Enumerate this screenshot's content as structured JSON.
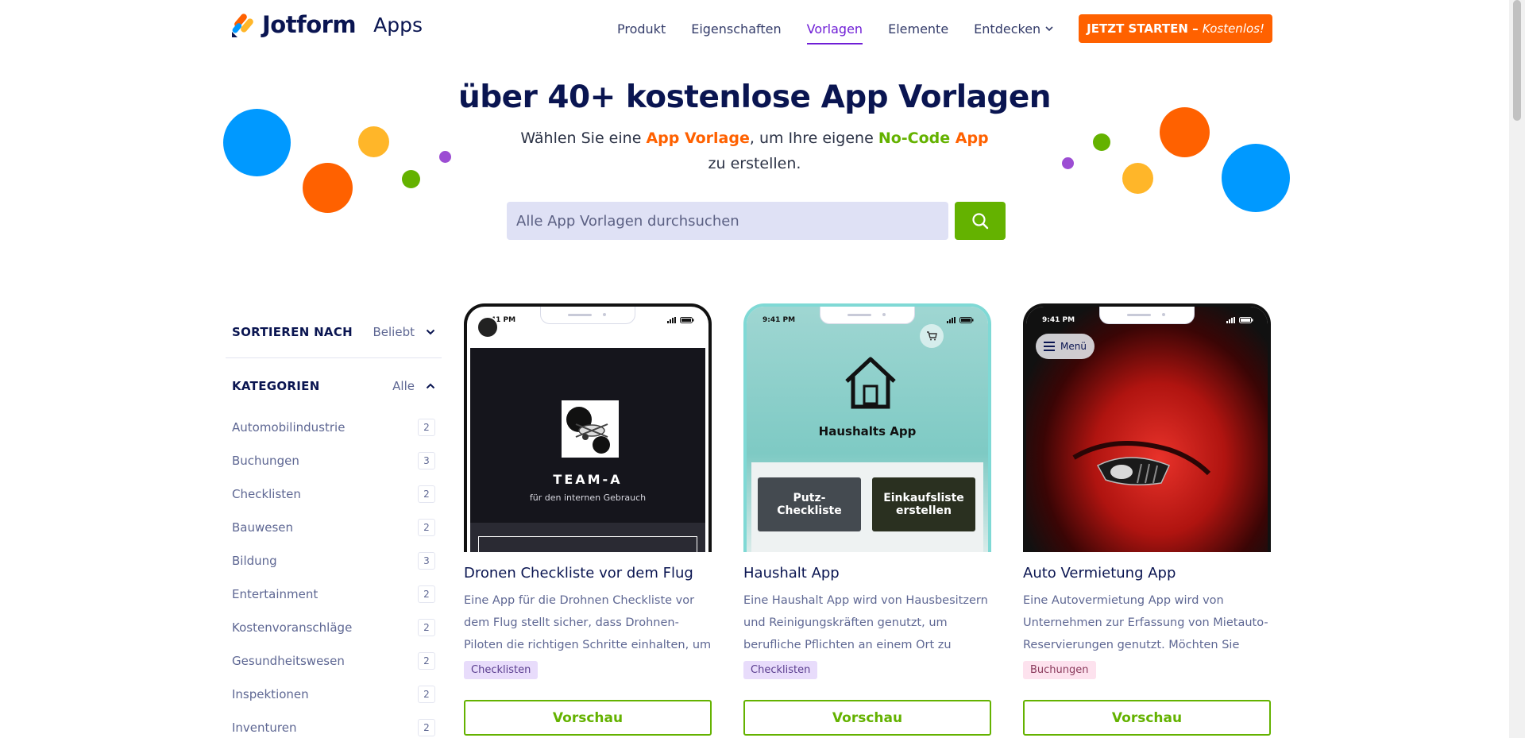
{
  "header": {
    "logo_text": "Jotform",
    "logo_sub": "Apps",
    "nav": [
      {
        "label": "Produkt",
        "active": false
      },
      {
        "label": "Eigenschaften",
        "active": false
      },
      {
        "label": "Vorlagen",
        "active": true
      },
      {
        "label": "Elemente",
        "active": false
      },
      {
        "label": "Entdecken",
        "active": false,
        "has_dropdown": true
      }
    ],
    "cta_main": "JETZT STARTEN",
    "cta_sep": " – ",
    "cta_em": "Kostenlos!"
  },
  "hero": {
    "title": "über 40+ kostenlose App Vorlagen",
    "sub_1": "Wählen Sie eine ",
    "sub_hl_1": "App Vorlage",
    "sub_2": ", um Ihre eigene ",
    "sub_hl_2": "No-Code",
    "sub_hl_3": " App",
    "sub_3": " zu erstellen.",
    "search_placeholder": "Alle App Vorlagen durchsuchen",
    "search_icon": "search-icon"
  },
  "sidebar": {
    "sort_label": "SORTIEREN NACH",
    "sort_value": "Beliebt",
    "categories_label": "KATEGORIEN",
    "categories_value": "Alle",
    "categories": [
      {
        "label": "Automobilindustrie",
        "count": "2"
      },
      {
        "label": "Buchungen",
        "count": "3"
      },
      {
        "label": "Checklisten",
        "count": "2"
      },
      {
        "label": "Bauwesen",
        "count": "2"
      },
      {
        "label": "Bildung",
        "count": "3"
      },
      {
        "label": "Entertainment",
        "count": "2"
      },
      {
        "label": "Kostenvoranschläge",
        "count": "2"
      },
      {
        "label": "Gesundheitswesen",
        "count": "2"
      },
      {
        "label": "Inspektionen",
        "count": "2"
      },
      {
        "label": "Inventuren",
        "count": "2"
      }
    ]
  },
  "cards": [
    {
      "title": "Dronen Checkliste vor dem Flug",
      "description": "Eine App für die Drohnen Checkliste vor dem Flug stellt sicher, dass Drohnen-Piloten die richtigen Schritte einhalten, um einen…",
      "tag": "Checklisten",
      "preview_label": "Vorschau",
      "screen_time": "9:41 PM",
      "screen_title": "TEAM-A",
      "screen_sub": "für den internen Gebrauch"
    },
    {
      "title": "Haushalt App",
      "description": "Eine Haushalt App wird von Hausbesitzern und Reinigungskräften genutzt, um berufliche Pflichten an einem Ort zu verwalten. Jotfor…",
      "tag": "Checklisten",
      "preview_label": "Vorschau",
      "screen_time": "9:41 PM",
      "screen_title": "Haushalts App",
      "tile_1": "Putz-Checkliste",
      "tile_2": "Einkaufsliste erstellen"
    },
    {
      "title": "Auto Vermietung App",
      "description": "Eine Autovermietung App wird von Unternehmen zur Erfassung von Mietauto-Reservierungen genutzt. Möchten Sie wisse…",
      "tag": "Buchungen",
      "preview_label": "Vorschau",
      "screen_time": "9:41 PM",
      "menu_label": "Menü"
    }
  ],
  "colors": {
    "brand_orange": "#ff6100",
    "brand_green": "#64b200",
    "brand_navy": "#0a1551",
    "accent_purple": "#6f1ed6",
    "dot_blue": "#0099ff",
    "dot_yellow": "#ffb629",
    "dot_purple": "#9c4dd3"
  }
}
